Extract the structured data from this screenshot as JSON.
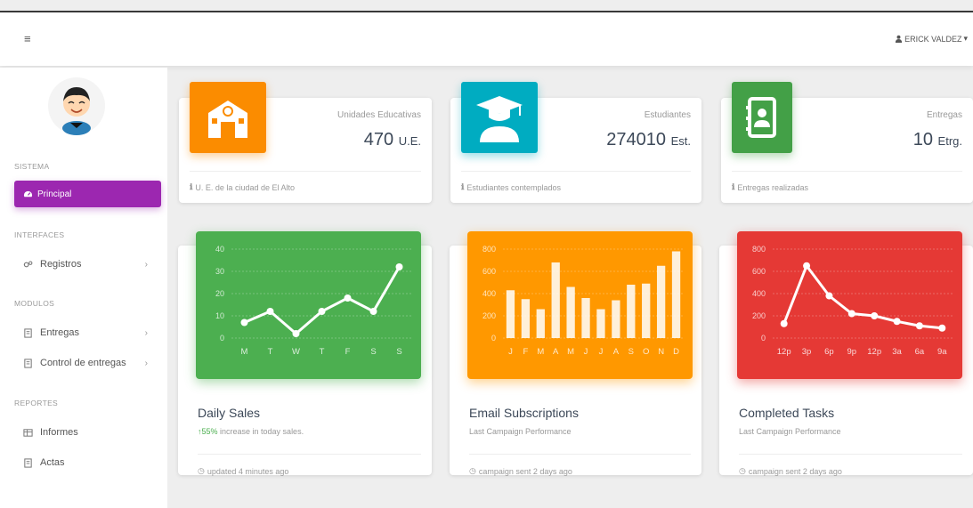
{
  "navbar": {
    "menu_icon": "hamburger-icon",
    "user_name": "ERICK VALDEZ",
    "user_icon": "user-icon",
    "caret": "▾"
  },
  "sidebar": {
    "avatar_icon": "avatar-icon",
    "sections": {
      "sistema": "SISTEMA",
      "interfaces": "INTERFACES",
      "modulos": "MODULOS",
      "reportes": "REPORTES"
    },
    "active_item": {
      "label": "Principal",
      "icon": "dashboard-icon"
    },
    "items": [
      {
        "label": "Registros",
        "icon": "gears-icon",
        "chevron": "›"
      },
      {
        "label": "Entregas",
        "icon": "file-icon",
        "chevron": "›"
      },
      {
        "label": "Control de entregas",
        "icon": "file-icon",
        "chevron": "›"
      },
      {
        "label": "Informes",
        "icon": "table-icon"
      },
      {
        "label": "Actas",
        "icon": "file-icon"
      }
    ]
  },
  "stats": [
    {
      "category": "Unidades Educativas",
      "value": "470",
      "unit": "U.E.",
      "footer": "U. E. de la ciudad de El Alto",
      "color": "#fb8c00",
      "icon": "school-icon"
    },
    {
      "category": "Estudiantes",
      "value": "274010",
      "unit": "Est.",
      "footer": "Estudiantes contemplados",
      "color": "#00acc1",
      "icon": "graduate-icon"
    },
    {
      "category": "Entregas",
      "value": "10",
      "unit": "Etrg.",
      "footer": "Entregas realizadas",
      "color": "#43a047",
      "icon": "contacts-book-icon"
    }
  ],
  "charts": [
    {
      "title": "Daily Sales",
      "subtitle_pct": "55%",
      "subtitle_rest": " increase in today sales.",
      "footer": "updated 4 minutes ago",
      "color": "#4caf50"
    },
    {
      "title": "Email Subscriptions",
      "subtitle": "Last Campaign Performance",
      "footer": "campaign sent 2 days ago",
      "color": "#ff9800"
    },
    {
      "title": "Completed Tasks",
      "subtitle": "Last Campaign Performance",
      "footer": "campaign sent 2 days ago",
      "color": "#e53935"
    }
  ],
  "chart_data": [
    {
      "type": "line",
      "categories": [
        "M",
        "T",
        "W",
        "T",
        "F",
        "S",
        "S"
      ],
      "values": [
        7,
        12,
        2,
        12,
        18,
        12,
        32
      ],
      "yticks": [
        "40",
        "30",
        "20",
        "10",
        "0"
      ],
      "ylim": [
        0,
        40
      ]
    },
    {
      "type": "bar",
      "categories": [
        "J",
        "F",
        "M",
        "A",
        "M",
        "J",
        "J",
        "A",
        "S",
        "O",
        "N",
        "D"
      ],
      "values": [
        430,
        350,
        260,
        680,
        460,
        360,
        260,
        340,
        480,
        490,
        650,
        780
      ],
      "yticks": [
        "800",
        "600",
        "400",
        "200",
        "0"
      ],
      "ylim": [
        0,
        800
      ]
    },
    {
      "type": "line",
      "categories": [
        "12p",
        "3p",
        "6p",
        "9p",
        "12p",
        "3a",
        "6a",
        "9a"
      ],
      "values": [
        130,
        650,
        380,
        220,
        200,
        150,
        110,
        90
      ],
      "yticks": [
        "800",
        "600",
        "400",
        "200",
        "0"
      ],
      "ylim": [
        0,
        800
      ]
    }
  ]
}
